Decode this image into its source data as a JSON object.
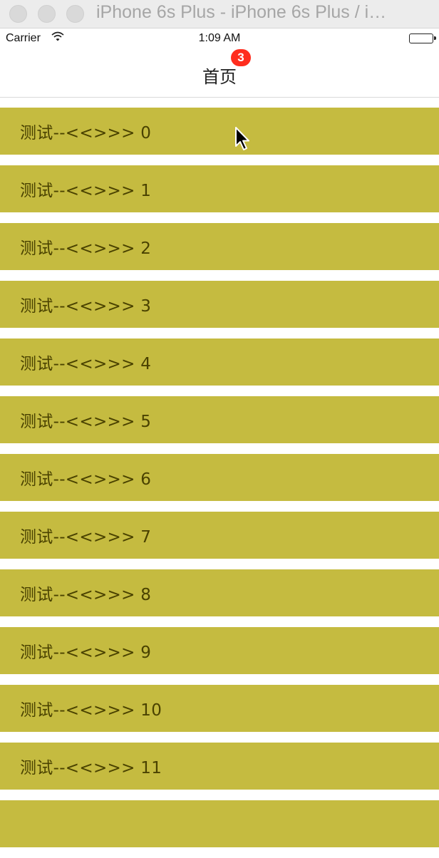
{
  "window": {
    "title": "iPhone 6s Plus - iPhone 6s Plus / i…"
  },
  "status_bar": {
    "carrier": "Carrier",
    "wifi_icon": "wifi-icon",
    "time": "1:09 AM",
    "battery_icon": "battery-icon"
  },
  "nav": {
    "title": "首页",
    "badge": "3"
  },
  "colors": {
    "row_background": "#c5bb40",
    "badge": "#ff2d1e"
  },
  "list": {
    "items": [
      {
        "label": "测试--<<>>> 0"
      },
      {
        "label": "测试--<<>>> 1"
      },
      {
        "label": "测试--<<>>> 2"
      },
      {
        "label": "测试--<<>>> 3"
      },
      {
        "label": "测试--<<>>> 4"
      },
      {
        "label": "测试--<<>>> 5"
      },
      {
        "label": "测试--<<>>> 6"
      },
      {
        "label": "测试--<<>>> 7"
      },
      {
        "label": "测试--<<>>> 8"
      },
      {
        "label": "测试--<<>>> 9"
      },
      {
        "label": "测试--<<>>> 10"
      },
      {
        "label": "测试--<<>>> 11"
      },
      {
        "label": ""
      }
    ]
  }
}
